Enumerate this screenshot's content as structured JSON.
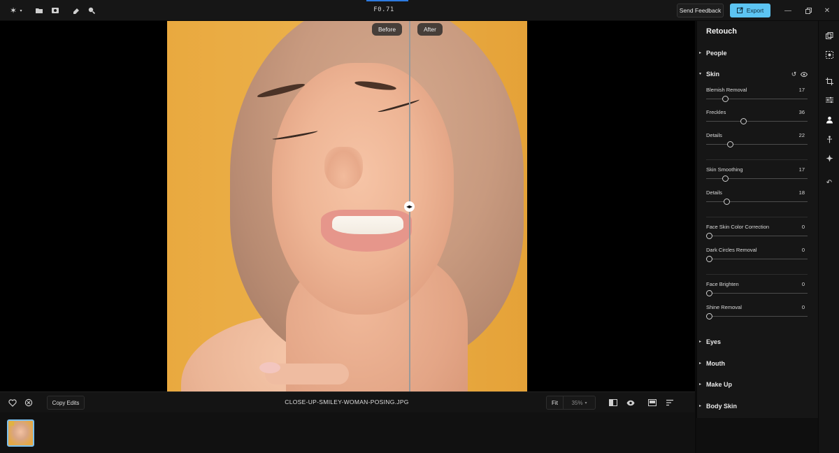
{
  "window": {
    "title": "F0.71",
    "send_feedback_label": "Send Feedback",
    "export_label": "Export"
  },
  "top_tools": {
    "icons": [
      "app-logo-icon",
      "folder-icon",
      "gallery-icon",
      "eraser-icon",
      "search-icon"
    ]
  },
  "canvas": {
    "before_label": "Before",
    "after_label": "After"
  },
  "bottombar": {
    "copy_edits_label": "Copy Edits",
    "filename": "CLOSE-UP-SMILEY-WOMAN-POSING.JPG",
    "fit_label": "Fit",
    "zoom_value": "35%"
  },
  "panel": {
    "title": "Retouch",
    "sections": {
      "people": "People",
      "skin": "Skin",
      "eyes": "Eyes",
      "mouth": "Mouth",
      "makeup": "Make Up",
      "body_skin": "Body Skin"
    },
    "sliders": [
      {
        "label": "Blemish Removal",
        "value": "17",
        "level": 0.17
      },
      {
        "label": "Freckles",
        "value": "36",
        "level": 0.36
      },
      {
        "label": "Details",
        "value": "22",
        "level": 0.22
      },
      {
        "label": "Skin Smoothing",
        "value": "17",
        "level": 0.17
      },
      {
        "label": "Details",
        "value": "18",
        "level": 0.18
      },
      {
        "label": "Face Skin Color Correction",
        "value": "0",
        "level": 0
      },
      {
        "label": "Dark Circles Removal",
        "value": "0",
        "level": 0
      },
      {
        "label": "Face Brighten",
        "value": "0",
        "level": 0
      },
      {
        "label": "Shine Removal",
        "value": "0",
        "level": 0
      }
    ]
  },
  "colors": {
    "export_button": "#5cc4f2",
    "accent": "#2d7be0",
    "thumbnail_border": "#7cc0ee"
  }
}
